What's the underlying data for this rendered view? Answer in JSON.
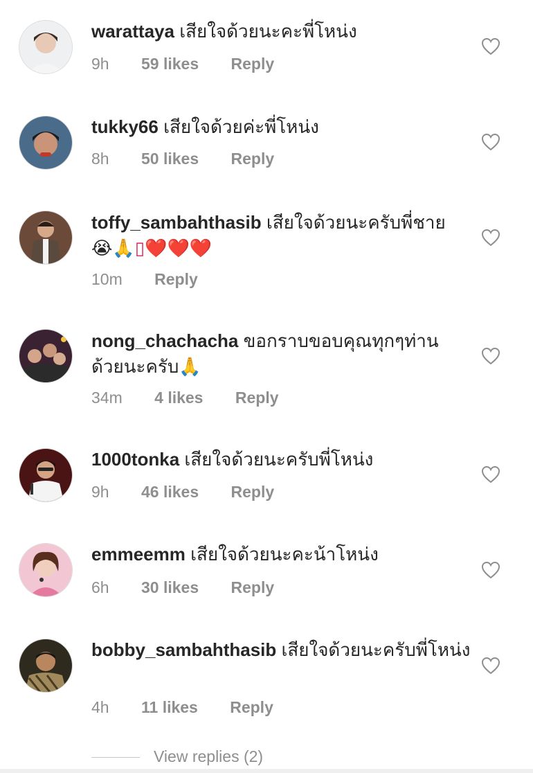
{
  "comments": [
    {
      "username": "warattaya",
      "text": "เสียใจด้วยนะคะพี่โหน่ง",
      "time": "9h",
      "likes": "59 likes",
      "reply": "Reply"
    },
    {
      "username": "tukky66",
      "text": "เสียใจด้วยค่ะพี่โหน่ง",
      "time": "8h",
      "likes": "50 likes",
      "reply": "Reply"
    },
    {
      "username": "toffy_sambahthasib",
      "text": "เสียใจด้วยนะครับพี่ชาย 😭🙏",
      "emoji": "▯❤️❤️❤️",
      "time": "10m",
      "likes": "",
      "reply": "Reply"
    },
    {
      "username": "nong_chachacha",
      "text": "ขอกราบขอบคุณทุกๆท่านด้วยนะครับ🙏",
      "time": "34m",
      "likes": "4 likes",
      "reply": "Reply"
    },
    {
      "username": "1000tonka",
      "text": "เสียใจด้วยนะครับพี่โหน่ง",
      "time": "9h",
      "likes": "46 likes",
      "reply": "Reply"
    },
    {
      "username": "emmeemm",
      "text": "เสียใจด้วยนะคะน้าโหน่ง",
      "time": "6h",
      "likes": "30 likes",
      "reply": "Reply"
    },
    {
      "username": "bobby_sambahthasib",
      "text": "เสียใจด้วยนะครับพี่โหน่ง",
      "time": "4h",
      "likes": "11 likes",
      "reply": "Reply"
    }
  ],
  "view_replies": "View replies (2)",
  "icons": {
    "like": "heart-outline-icon",
    "avatar": "user-avatar"
  },
  "colors": {
    "text": "#262626",
    "secondary": "#8e8e8e",
    "heart_stroke": "#8e8e8e"
  }
}
